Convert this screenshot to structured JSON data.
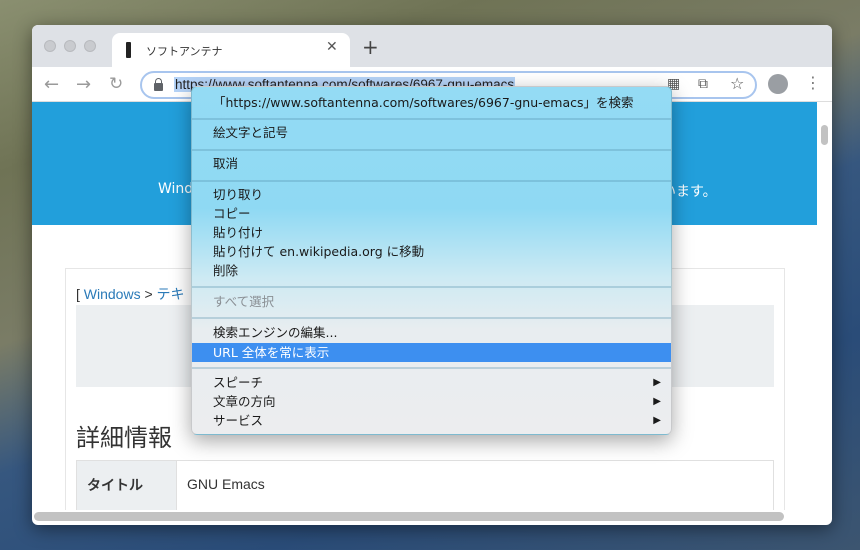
{
  "browser": {
    "tab_title": "ソフトアンテナ",
    "url": "https://www.softantenna.com/softwares/6967-gnu-emacs"
  },
  "page": {
    "banner_left": "Wind",
    "banner_right": "います。",
    "breadcrumb_start": "[ ",
    "breadcrumb_link1": "Windows",
    "breadcrumb_sep": " > ",
    "breadcrumb_link2": "テキ",
    "heading": "詳細情報",
    "table": {
      "header": "タイトル",
      "value": "GNU Emacs"
    }
  },
  "menu": {
    "search": "「https://www.softantenna.com/softwares/6967-gnu-emacs」を検索",
    "emoji": "絵文字と記号",
    "undo": "取消",
    "cut": "切り取り",
    "copy": "コピー",
    "paste": "貼り付け",
    "paste_go": "貼り付けて en.wikipedia.org に移動",
    "delete": "削除",
    "select_all": "すべて選択",
    "edit_engines": "検索エンジンの編集...",
    "show_full_url": "URL 全体を常に表示",
    "speech": "スピーチ",
    "direction": "文章の方向",
    "services": "サービス"
  }
}
